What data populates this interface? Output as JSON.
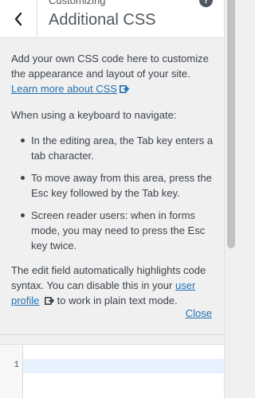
{
  "header": {
    "breadcrumb": "Customizing",
    "title": "Additional CSS",
    "help_symbol": "?"
  },
  "description": {
    "intro": "Add your own CSS code here to customize the appearance and layout of your site.",
    "learn_more_link": "Learn more about CSS",
    "keyboard_heading": "When using a keyboard to navigate:",
    "list_items": [
      "In the editing area, the Tab key enters a tab character.",
      "To move away from this area, press the Esc key followed by the Tab key.",
      "Screen reader users: when in forms mode, you may need to press the Esc key twice."
    ],
    "auto_highlight_text": "The edit field automatically highlights code syntax. You can disable this in your",
    "user_profile_link": "user profile",
    "plain_text_suffix": "to work in plain text mode.",
    "close_link": "Close"
  },
  "editor": {
    "line_numbers": [
      "1"
    ],
    "value": ""
  },
  "colors": {
    "link": "#2271b1",
    "text": "#3c434a",
    "panel_bg": "#f0f0f1",
    "active_line": "#e8f2ff"
  },
  "icons": {
    "back": "chevron-left-icon",
    "help": "help-icon",
    "external": "external-link-icon"
  }
}
